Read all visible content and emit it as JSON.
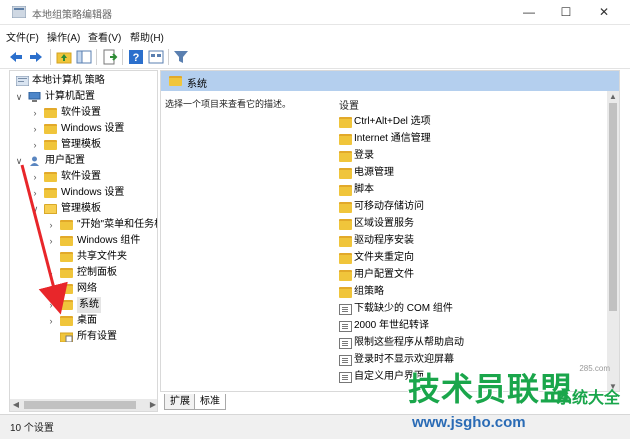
{
  "window": {
    "title": "本地组策略编辑器",
    "minimize": "—",
    "maximize": "☐",
    "close": "✕"
  },
  "menu": [
    {
      "label": "文件(F)"
    },
    {
      "label": "操作(A)"
    },
    {
      "label": "查看(V)"
    },
    {
      "label": "帮助(H)"
    }
  ],
  "toolbar": {
    "icons": [
      "back-arrow-icon",
      "forward-arrow-icon",
      "up-folder-icon",
      "show-hide-tree-icon",
      "export-list-icon",
      "help-icon",
      "properties-view-icon",
      "filter-icon"
    ]
  },
  "tree": [
    {
      "label": "本地计算机 策略",
      "arrow": "",
      "level": 0
    },
    {
      "label": "计算机配置",
      "arrow": "∨",
      "level": 1
    },
    {
      "label": "软件设置",
      "arrow": "›",
      "level": 2
    },
    {
      "label": "Windows 设置",
      "arrow": "›",
      "level": 2
    },
    {
      "label": "管理模板",
      "arrow": "›",
      "level": 2
    },
    {
      "label": "用户配置",
      "arrow": "∨",
      "level": 1
    },
    {
      "label": "软件设置",
      "arrow": "›",
      "level": 2
    },
    {
      "label": "Windows 设置",
      "arrow": "›",
      "level": 2
    },
    {
      "label": "管理模板",
      "arrow": "∨",
      "level": 2
    },
    {
      "label": "\"开始\"菜单和任务栏",
      "arrow": "›",
      "level": 3
    },
    {
      "label": "Windows 组件",
      "arrow": "›",
      "level": 3
    },
    {
      "label": "共享文件夹",
      "arrow": "",
      "level": 3
    },
    {
      "label": "控制面板",
      "arrow": "›",
      "level": 3
    },
    {
      "label": "网络",
      "arrow": "›",
      "level": 3
    },
    {
      "label": "系统",
      "arrow": "›",
      "level": 3,
      "selected": true
    },
    {
      "label": "桌面",
      "arrow": "›",
      "level": 3
    },
    {
      "label": "所有设置",
      "arrow": "",
      "level": 3
    }
  ],
  "right": {
    "header": "系统",
    "description": "选择一个项目来查看它的描述。",
    "column_header": "设置",
    "folders": [
      "Ctrl+Alt+Del 选项",
      "Internet 通信管理",
      "登录",
      "电源管理",
      "脚本",
      "可移动存储访问",
      "区域设置服务",
      "驱动程序安装",
      "文件夹重定向",
      "用户配置文件",
      "组策略"
    ],
    "policies": [
      "下载缺少的 COM 组件",
      "2000 年世纪转译",
      "限制这些程序从帮助启动",
      "登录时不显示欢迎屏幕",
      "自定义用户界面"
    ]
  },
  "tabs": [
    {
      "label": "扩展"
    },
    {
      "label": "标准"
    }
  ],
  "status": {
    "text": "10 个设置"
  },
  "watermark": {
    "brand": "技术员联盟",
    "side": "系统大全",
    "url": "www.jsgho.com",
    "small": "285.com"
  }
}
